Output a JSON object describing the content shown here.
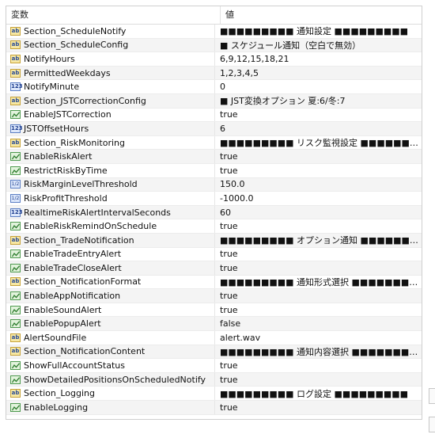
{
  "header": {
    "name_label": "変数",
    "value_label": "値"
  },
  "rows": [
    {
      "type": "ab",
      "name": "Section_ScheduleNotify",
      "value": "■■■■■■■■■ 通知設定 ■■■■■■■■■"
    },
    {
      "type": "ab",
      "name": "Section_ScheduleConfig",
      "value": "■ スケジュール通知（空白で無効）"
    },
    {
      "type": "ab",
      "name": "NotifyHours",
      "value": "6,9,12,15,18,21"
    },
    {
      "type": "ab",
      "name": "PermittedWeekdays",
      "value": "1,2,3,4,5"
    },
    {
      "type": "num",
      "name": "NotifyMinute",
      "value": "0"
    },
    {
      "type": "ab",
      "name": "Section_JSTCorrectionConfig",
      "value": "■ JST変換オプション 夏:6/冬:7"
    },
    {
      "type": "bool",
      "name": "EnableJSTCorrection",
      "value": "true"
    },
    {
      "type": "num",
      "name": "JSTOffsetHours",
      "value": "6"
    },
    {
      "type": "ab",
      "name": "Section_RiskMonitoring",
      "value": "■■■■■■■■■ リスク監視設定 ■■■■■■■·.."
    },
    {
      "type": "bool",
      "name": "EnableRiskAlert",
      "value": "true"
    },
    {
      "type": "bool",
      "name": "RestrictRiskByTime",
      "value": "true"
    },
    {
      "type": "flt",
      "name": "RiskMarginLevelThreshold",
      "value": "150.0"
    },
    {
      "type": "flt",
      "name": "RiskProfitThreshold",
      "value": "-1000.0"
    },
    {
      "type": "num",
      "name": "RealtimeRiskAlertIntervalSeconds",
      "value": "60"
    },
    {
      "type": "bool",
      "name": "EnableRiskRemindOnSchedule",
      "value": "true"
    },
    {
      "type": "ab",
      "name": "Section_TradeNotification",
      "value": "■■■■■■■■■ オプション通知 ■■■■■■■■■"
    },
    {
      "type": "bool",
      "name": "EnableTradeEntryAlert",
      "value": "true"
    },
    {
      "type": "bool",
      "name": "EnableTradeCloseAlert",
      "value": "true"
    },
    {
      "type": "ab",
      "name": "Section_NotificationFormat",
      "value": "■■■■■■■■■ 通知形式選択 ■■■■■■■■·.."
    },
    {
      "type": "bool",
      "name": "EnableAppNotification",
      "value": "true"
    },
    {
      "type": "bool",
      "name": "EnableSoundAlert",
      "value": "true"
    },
    {
      "type": "bool",
      "name": "EnablePopupAlert",
      "value": "false"
    },
    {
      "type": "ab",
      "name": "AlertSoundFile",
      "value": "alert.wav"
    },
    {
      "type": "ab",
      "name": "Section_NotificationContent",
      "value": "■■■■■■■■■ 通知内容選択 ■■■■■■■■·.."
    },
    {
      "type": "bool",
      "name": "ShowFullAccountStatus",
      "value": "true"
    },
    {
      "type": "bool",
      "name": "ShowDetailedPositionsOnScheduledNotify",
      "value": "true"
    },
    {
      "type": "ab",
      "name": "Section_Logging",
      "value": "■■■■■■■■■ ログ設定 ■■■■■■■■■"
    },
    {
      "type": "bool",
      "name": "EnableLogging",
      "value": "true"
    }
  ],
  "icons": {
    "ab": {
      "name": "string-type-icon",
      "glyph": "ab"
    },
    "num": {
      "name": "integer-type-icon",
      "glyph": "123"
    },
    "flt": {
      "name": "double-type-icon",
      "glyph": "1/2"
    },
    "bool": {
      "name": "bool-type-icon",
      "glyph": ""
    }
  }
}
